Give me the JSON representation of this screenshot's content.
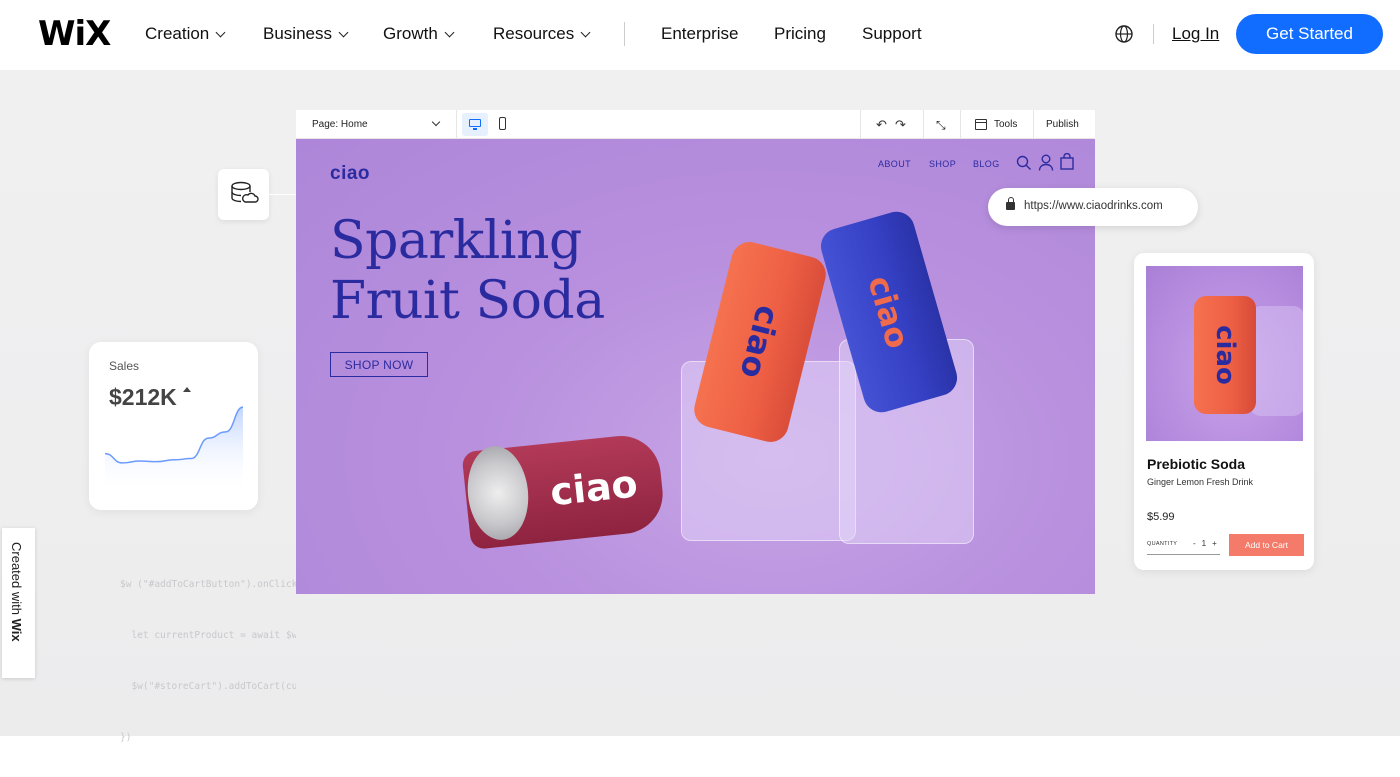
{
  "brand": {
    "logo": "WiX",
    "accent": "#116dff"
  },
  "nav": {
    "items": [
      {
        "label": "Creation",
        "dropdown": true
      },
      {
        "label": "Business",
        "dropdown": true
      },
      {
        "label": "Growth",
        "dropdown": true
      },
      {
        "label": "Resources",
        "dropdown": true
      },
      {
        "label": "Enterprise",
        "dropdown": false
      },
      {
        "label": "Pricing",
        "dropdown": false
      },
      {
        "label": "Support",
        "dropdown": false
      }
    ],
    "language_icon": "globe-icon",
    "login": "Log In",
    "cta": "Get Started"
  },
  "editor": {
    "page_select": "Page: Home",
    "tools": "Tools",
    "publish": "Publish"
  },
  "site": {
    "logo": "ciao",
    "nav": [
      "ABOUT",
      "SHOP",
      "BLOG"
    ],
    "headline_line1": "Sparkling",
    "headline_line2": "Fruit Soda",
    "cta": "SHOP NOW",
    "can_text": "ciao",
    "colors": {
      "bg": "#b890de",
      "ink": "#2b2ba0",
      "can_red": "#a52a4a",
      "can_orange": "#f06a4c",
      "can_blue": "#3540c4"
    }
  },
  "url_bar": {
    "url": "https://www.ciaodrinks.com"
  },
  "sales": {
    "label": "Sales",
    "value": "$212K",
    "trend": [
      0.2,
      0.05,
      0.08,
      0.07,
      0.1,
      0.12,
      0.45,
      0.55,
      0.95
    ]
  },
  "code_lines": [
    "$w (\"#addToCartButton\").onClick(as",
    "  let currentProduct = await $w(\"#pro",
    "  $w(\"#storeCart\").addToCart(curren",
    "})"
  ],
  "product": {
    "name": "Prebiotic Soda",
    "description": "Ginger Lemon Fresh Drink",
    "price": "$5.99",
    "quantity_label": "QUANTITY",
    "quantity_minus": "-",
    "quantity_value": "1",
    "quantity_plus": "+",
    "add_to_cart": "Add to Cart"
  },
  "side_tab": {
    "prefix": "Created with ",
    "brand": "Wix"
  }
}
